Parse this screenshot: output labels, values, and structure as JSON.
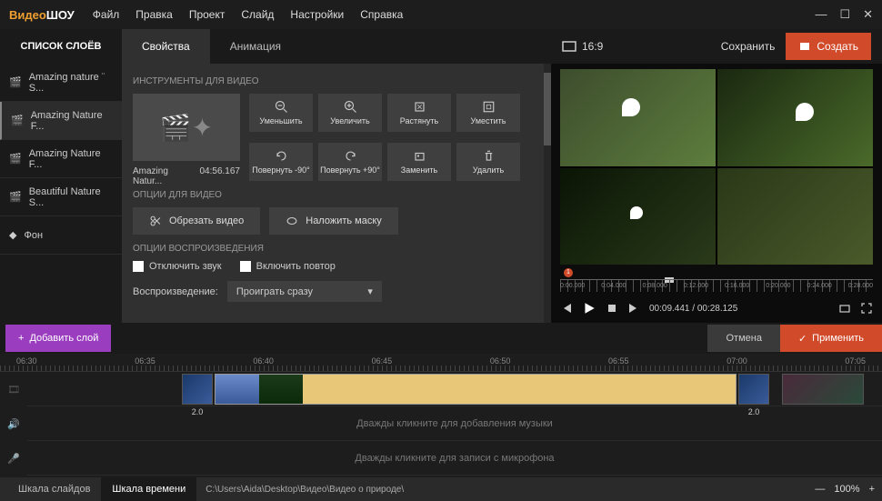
{
  "app": {
    "logo_y": "Видео",
    "logo_w": "ШОУ"
  },
  "menu": [
    "Файл",
    "Правка",
    "Проект",
    "Слайд",
    "Настройки",
    "Справка"
  ],
  "header": {
    "layers_title": "СПИСОК СЛОЁВ",
    "tab_props": "Свойства",
    "tab_anim": "Анимация"
  },
  "preview": {
    "aspect": "16:9",
    "save": "Сохранить",
    "create": "Создать",
    "marker": "1",
    "time": "00:09.441 / 00:28.125",
    "ticks": [
      "0:00.000",
      "0:04.000",
      "0:08.000",
      "0:12.000",
      "0:16.000",
      "0:20.000",
      "0:24.000",
      "0:28.000"
    ]
  },
  "layers": {
    "l1": "Amazing nature ¨ S...",
    "l2": "Amazing Nature F...",
    "l3": "Amazing Nature F...",
    "l4": "Beautiful Nature S...",
    "l5": "Фон"
  },
  "props": {
    "section_tools": "ИНСТРУМЕНТЫ ДЛЯ ВИДЕО",
    "thumb_name": "Amazing Natur...",
    "thumb_dur": "04:56.167",
    "btn": {
      "zoom_out": "Уменьшить",
      "zoom_in": "Увеличить",
      "stretch": "Растянуть",
      "fit": "Уместить",
      "rot_ccw": "Повернуть -90°",
      "rot_cw": "Повернуть +90°",
      "replace": "Заменить",
      "delete": "Удалить"
    },
    "section_opts": "ОПЦИИ ДЛЯ ВИДЕО",
    "crop": "Обрезать видео",
    "mask": "Наложить маску",
    "section_play": "ОПЦИИ ВОСПРОИЗВЕДЕНИЯ",
    "mute": "Отключить звук",
    "loop": "Включить повтор",
    "play_label": "Воспроизведение:",
    "play_val": "Проиграть сразу"
  },
  "row2": {
    "add_layer": "Добавить слой",
    "cancel": "Отмена",
    "apply": "Применить"
  },
  "timeline": {
    "ruler": [
      "06:30",
      "06:35",
      "06:40",
      "06:45",
      "06:50",
      "06:55",
      "07:00",
      "07:05"
    ],
    "trans_dur": "2.0",
    "music_hint": "Дважды кликните для добавления музыки",
    "mic_hint": "Дважды кликните для записи с микрофона"
  },
  "footer": {
    "tab_slides": "Шкала слайдов",
    "tab_time": "Шкала времени",
    "path": "C:\\Users\\Aida\\Desktop\\Видео\\Видео о природе\\",
    "zoom": "100%"
  }
}
